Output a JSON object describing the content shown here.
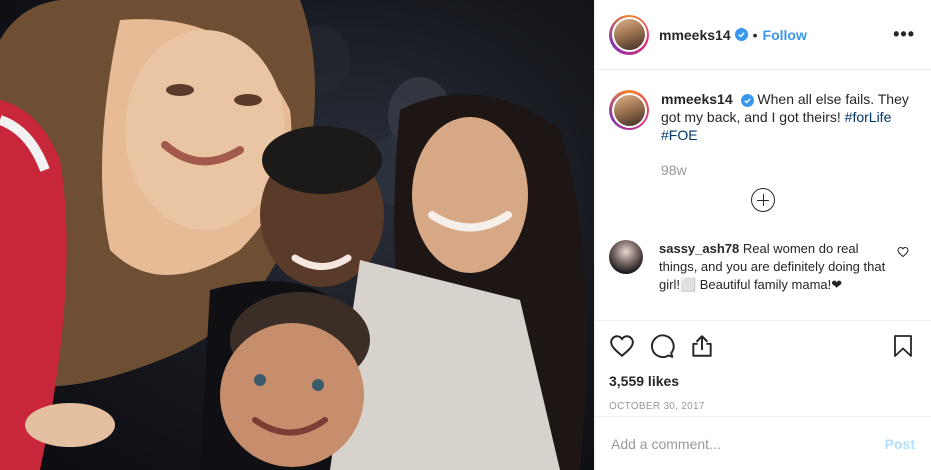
{
  "post": {
    "image_alt": "Selfie of a woman with a teenage girl and two boys",
    "header": {
      "username": "mmeeks14",
      "separator": "•",
      "follow_label": "Follow",
      "more_label": "•••"
    },
    "caption": {
      "username": "mmeeks14",
      "text": "When all else fails. They got my back, and I got theirs!",
      "hashtags": [
        "#forLife",
        "#FOE"
      ],
      "time_ago": "98w"
    },
    "comments": [
      {
        "username": "sassy_ash78",
        "text": "Real women do real things, and you are definitely doing that girl!⬜ Beautiful family mama!❤"
      }
    ],
    "likes": "3,559 likes",
    "date": "OCTOBER 30, 2017",
    "add_comment": {
      "placeholder": "Add a comment...",
      "post_label": "Post"
    }
  },
  "icons": {
    "verified": "verified-badge-icon",
    "like": "heart-icon",
    "comment": "comment-bubble-icon",
    "share": "share-icon",
    "save": "bookmark-icon",
    "load_more": "plus-circle-icon"
  },
  "colors": {
    "accent": "#3897f0",
    "hashtag": "#003569",
    "muted": "#999999",
    "post_disabled": "#b2dffc"
  }
}
